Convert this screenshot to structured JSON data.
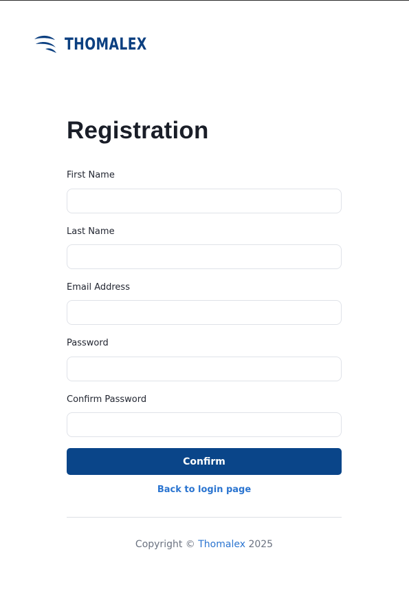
{
  "brand": {
    "name": "THOMALEX",
    "logo_icon": "wave-logo-icon",
    "color": "#0b3f80"
  },
  "page": {
    "title": "Registration"
  },
  "form": {
    "fields": [
      {
        "label": "First Name",
        "value": "",
        "placeholder": ""
      },
      {
        "label": "Last Name",
        "value": "",
        "placeholder": ""
      },
      {
        "label": "Email Address",
        "value": "",
        "placeholder": ""
      },
      {
        "label": "Password",
        "value": "",
        "placeholder": ""
      },
      {
        "label": "Confirm Password",
        "value": "",
        "placeholder": ""
      }
    ],
    "confirm_label": "Confirm",
    "back_link_label": "Back to login page"
  },
  "footer": {
    "prefix": "Copyright ©",
    "company": "Thomalex",
    "year": "2025"
  },
  "colors": {
    "primary": "#0a4589",
    "link": "#2a74d0"
  }
}
